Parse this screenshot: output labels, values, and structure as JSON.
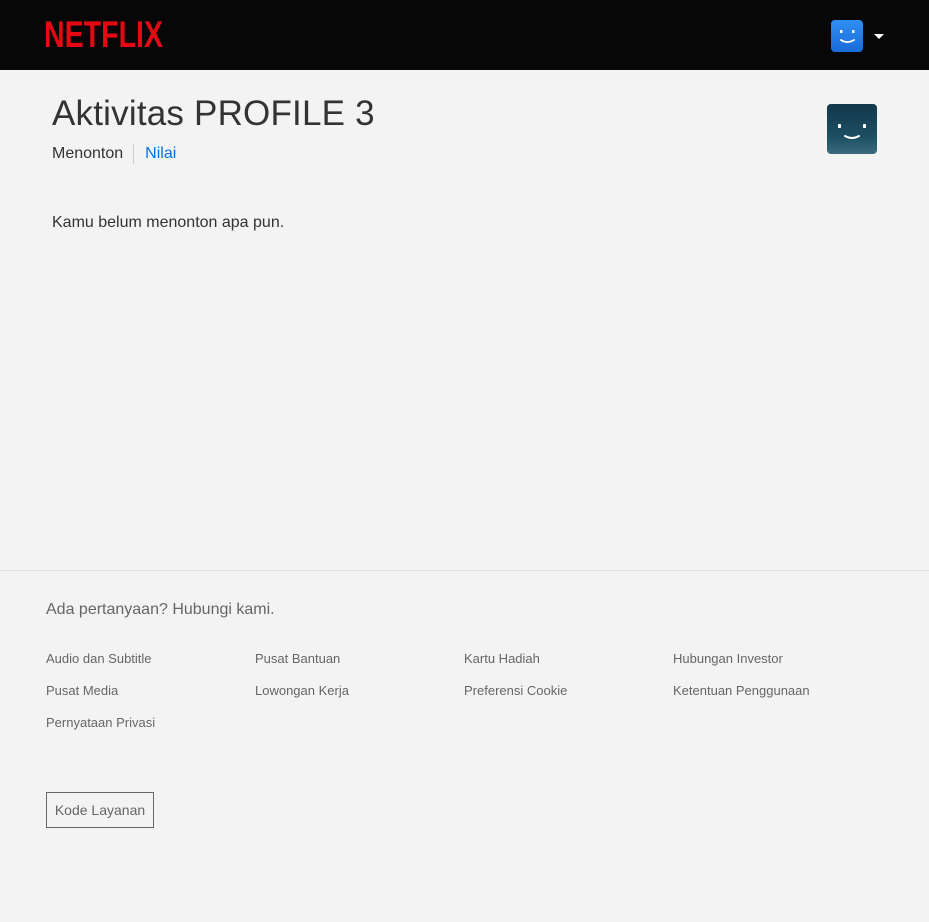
{
  "header": {
    "brand": "NETFLIX",
    "brand_color": "#e50914",
    "profile_menu_icon": "caret-down-icon"
  },
  "main": {
    "title": "Aktivitas PROFILE 3",
    "tabs": [
      {
        "label": "Menonton",
        "active": true
      },
      {
        "label": "Nilai",
        "active": false
      }
    ],
    "empty_message": "Kamu belum menonton apa pun."
  },
  "footer": {
    "question": "Ada pertanyaan? Hubungi kami.",
    "links": [
      {
        "label": "Audio dan Subtitle"
      },
      {
        "label": "Pusat Bantuan"
      },
      {
        "label": "Kartu Hadiah"
      },
      {
        "label": "Hubungan Investor"
      },
      {
        "label": "Pusat Media"
      },
      {
        "label": "Lowongan Kerja"
      },
      {
        "label": "Preferensi Cookie"
      },
      {
        "label": "Ketentuan Penggunaan"
      },
      {
        "label": "Pernyataan Privasi"
      }
    ],
    "service_code_label": "Kode Layanan"
  },
  "colors": {
    "header_bg": "#070707",
    "page_bg": "#f3f3f3",
    "link_blue": "#0073e6",
    "avatar_blue": "#2f8ff0",
    "avatar_teal": "#1d4f63"
  }
}
